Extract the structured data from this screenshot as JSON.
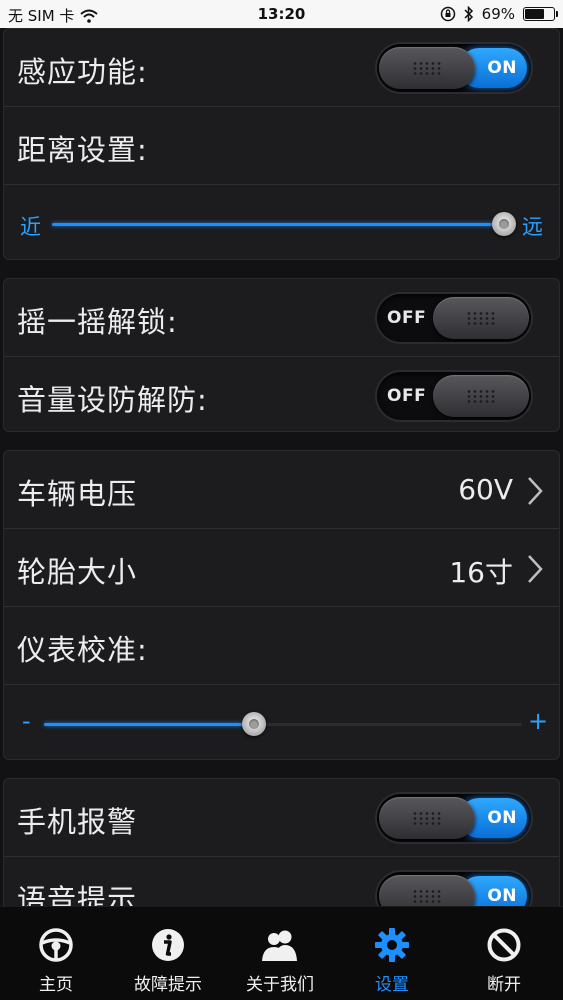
{
  "status_bar": {
    "carrier": "无 SIM 卡",
    "time": "13:20",
    "battery_percent": "69%",
    "battery_level": 0.69,
    "icons": [
      "wifi-icon",
      "orientation-lock-icon",
      "bluetooth-icon",
      "battery-icon"
    ]
  },
  "settings": {
    "sensing": {
      "label": "感应功能:",
      "state": "ON"
    },
    "distance": {
      "label": "距离设置:",
      "near": "近",
      "far": "远",
      "level": 1.0
    },
    "shake_unlock": {
      "label": "摇一摇解锁:",
      "state": "OFF"
    },
    "volume_arm": {
      "label": "音量设防解防:",
      "state": "OFF"
    },
    "voltage": {
      "label": "车辆电压",
      "value": "60V"
    },
    "tire_size": {
      "label": "轮胎大小",
      "value": "16寸"
    },
    "calibration": {
      "label": "仪表校准:",
      "minus": "-",
      "plus": "+",
      "level": 0.44
    },
    "phone_alarm": {
      "label": "手机报警",
      "state": "ON"
    },
    "voice_prompt": {
      "label": "语音提示",
      "state": "ON"
    }
  },
  "tabs": [
    {
      "label": "主页",
      "icon": "steering-wheel-icon",
      "active": false
    },
    {
      "label": "故障提示",
      "icon": "info-icon",
      "active": false
    },
    {
      "label": "关于我们",
      "icon": "people-icon",
      "active": false
    },
    {
      "label": "设置",
      "icon": "gear-icon",
      "active": true
    },
    {
      "label": "断开",
      "icon": "disconnect-icon",
      "active": false
    }
  ],
  "colors": {
    "accent": "#1e8fff",
    "background": "#121214",
    "panel": "#1c1c1f",
    "text": "#ececee"
  }
}
